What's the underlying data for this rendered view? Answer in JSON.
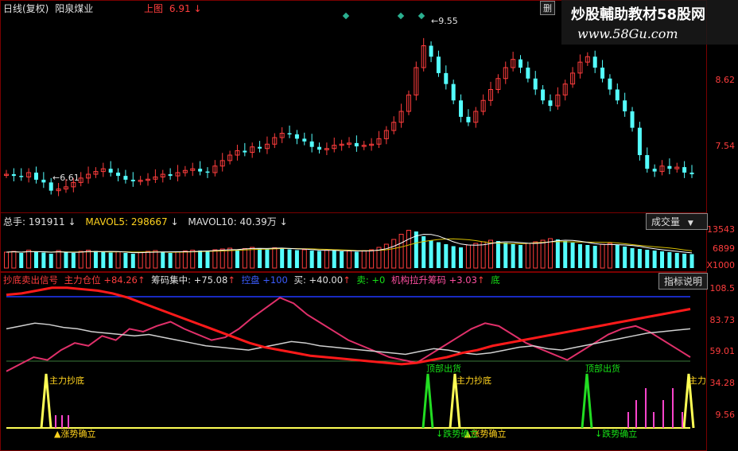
{
  "main": {
    "label1": "日线(复权)",
    "stock_name": "阳泉煤业",
    "upper_label": "上图",
    "upper_value": "6.91",
    "upper_arrow": "↓",
    "delete_label": "删",
    "price_high": "9.55",
    "price_low": "6.61",
    "scale": [
      "8.62",
      "7.54"
    ]
  },
  "watermark": {
    "title": "炒股輔助教材58股网",
    "url": "www.58Gu.com"
  },
  "volume": {
    "total_label": "总手:",
    "total_value": "191911",
    "ma5_label": "MAVOL5:",
    "ma5_value": "298667",
    "ma10_label": "MAVOL10:",
    "ma10_value": "40.39万",
    "button_label": "成交量",
    "scale": [
      "13543",
      "6899",
      "X1000"
    ]
  },
  "indicator": {
    "title": "抄底卖出信号",
    "zhuli_label": "主力仓位",
    "zhuli_value": "+84.26",
    "chouma_label": "筹码集中:",
    "chouma_value": "+75.08",
    "blue_label": "控盘",
    "blue_value": "+100",
    "buy_label": "买:",
    "buy_value": "+40.00",
    "sell_label": "卖:",
    "sell_value": "+0",
    "jigou_label": "机构拉升筹码",
    "jigou_value": "+3.03",
    "di_label": "底",
    "button_label": "指标说明",
    "scale": [
      "108.5",
      "83.73",
      "59.01",
      "34.28",
      "9.56"
    ],
    "annotations": {
      "chaodi": "主力抄底",
      "chaodi_right": "主力",
      "chuhuo": "顶部出货",
      "zhangshi": "涨势确立",
      "dieshi": "跌势确立"
    }
  },
  "colors": {
    "up": "#ff3d3d",
    "down": "#54ffff",
    "grid": "#7a0000",
    "yellow": "#ffff55",
    "green": "#22dd22",
    "pink": "#e0306a",
    "red_line": "#ff1a1a"
  },
  "price_series": [
    6.95,
    6.92,
    6.9,
    6.98,
    6.85,
    6.8,
    6.65,
    6.68,
    6.72,
    6.8,
    6.88,
    6.95,
    7.0,
    7.05,
    6.98,
    6.92,
    6.85,
    6.82,
    6.84,
    6.86,
    6.9,
    6.95,
    6.92,
    6.98,
    7.02,
    7.05,
    7.0,
    6.98,
    7.1,
    7.2,
    7.3,
    7.38,
    7.35,
    7.45,
    7.42,
    7.5,
    7.62,
    7.7,
    7.68,
    7.6,
    7.55,
    7.45,
    7.4,
    7.42,
    7.48,
    7.5,
    7.52,
    7.46,
    7.48,
    7.5,
    7.6,
    7.75,
    7.9,
    8.1,
    8.4,
    8.9,
    9.3,
    9.1,
    8.8,
    8.6,
    8.3,
    8.0,
    7.9,
    8.1,
    8.3,
    8.5,
    8.7,
    8.9,
    9.05,
    8.9,
    8.7,
    8.5,
    8.3,
    8.2,
    8.4,
    8.6,
    8.8,
    9.0,
    9.1,
    8.9,
    8.7,
    8.5,
    8.3,
    8.1,
    7.8,
    7.3,
    7.05,
    7.0,
    7.1,
    7.05,
    7.08,
    6.98,
    6.95
  ],
  "volume_series": [
    40,
    42,
    38,
    45,
    41,
    39,
    36,
    44,
    40,
    38,
    42,
    45,
    43,
    40,
    39,
    41,
    38,
    36,
    40,
    42,
    44,
    40,
    38,
    41,
    43,
    45,
    44,
    42,
    46,
    48,
    50,
    47,
    49,
    52,
    50,
    48,
    51,
    50,
    47,
    45,
    46,
    44,
    43,
    45,
    44,
    42,
    43,
    41,
    44,
    46,
    52,
    60,
    72,
    85,
    95,
    92,
    80,
    70,
    65,
    60,
    55,
    52,
    58,
    62,
    66,
    70,
    68,
    64,
    60,
    58,
    62,
    66,
    70,
    74,
    72,
    68,
    64,
    60,
    58,
    56,
    60,
    62,
    58,
    54,
    50,
    48,
    46,
    44,
    42,
    40,
    38,
    36,
    35
  ],
  "indicator_series": {
    "red": [
      94,
      95,
      97,
      99,
      99,
      98,
      97,
      95,
      92,
      88,
      84,
      80,
      76,
      72,
      68,
      64,
      60,
      57,
      55,
      53,
      51,
      50,
      49,
      48,
      47,
      46,
      45,
      46,
      48,
      50,
      53,
      55,
      58,
      60,
      62,
      64,
      66,
      68,
      70,
      72,
      74,
      76,
      78,
      80,
      82,
      84
    ],
    "white": [
      70,
      72,
      74,
      73,
      71,
      70,
      68,
      67,
      66,
      65,
      66,
      64,
      62,
      60,
      58,
      57,
      56,
      55,
      57,
      59,
      61,
      60,
      58,
      57,
      56,
      55,
      54,
      53,
      52,
      54,
      56,
      55,
      53,
      52,
      53,
      55,
      57,
      58,
      56,
      55,
      57,
      59,
      61,
      63,
      65,
      67,
      68,
      69,
      70
    ],
    "pink": [
      40,
      45,
      50,
      48,
      55,
      60,
      58,
      65,
      62,
      70,
      68,
      72,
      75,
      70,
      66,
      62,
      64,
      70,
      78,
      85,
      92,
      88,
      80,
      74,
      68,
      62,
      58,
      54,
      50,
      48,
      46,
      52,
      58,
      64,
      70,
      74,
      72,
      66,
      60,
      56,
      52,
      48,
      54,
      60,
      66,
      70,
      72,
      68,
      62,
      56,
      50
    ]
  }
}
